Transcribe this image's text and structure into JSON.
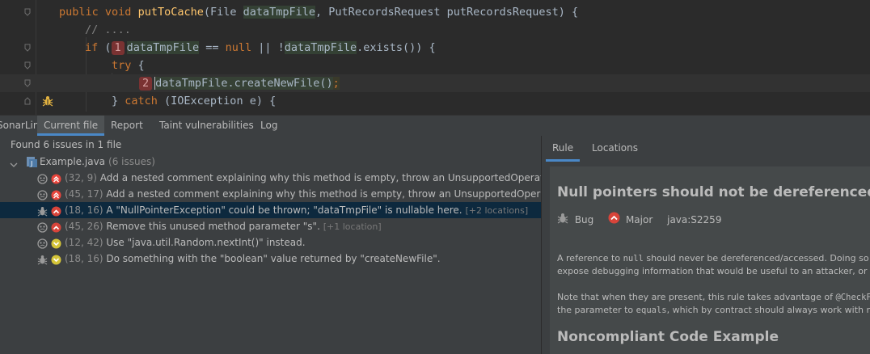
{
  "editor": {
    "line1": {
      "kw1": "public",
      "kw2": "void",
      "method": "putToCache",
      "p_open": "(File ",
      "param1": "dataTmpFile",
      "p_mid": ", PutRecordsRequest putRecordsRequest) {"
    },
    "line2": {
      "comment": "// ...."
    },
    "line3": {
      "kw": "if",
      "open": " (",
      "badge": "1",
      "var": "dataTmpFile",
      "op": " == ",
      "null_kw": "null",
      "mid": " || !",
      "var2": "dataTmpFile",
      "tail": ".exists()) {"
    },
    "line4": {
      "kw": "try",
      "tail": " {"
    },
    "line5": {
      "badge": "2",
      "var": "dataTmpFile",
      "call": ".createNewFile()",
      "semi": ";"
    },
    "line6": {
      "open": "} ",
      "kw": "catch",
      "tail": " (IOException e) {"
    }
  },
  "toolwindow": {
    "title": "SonarLint:",
    "tabs": [
      "Current file",
      "Report",
      "Taint vulnerabilities",
      "Log"
    ],
    "selected_tab": "Current file"
  },
  "issues": {
    "summary": "Found 6 issues in 1 file",
    "file_name": "Example.java",
    "file_count": "(6 issues)",
    "items": [
      {
        "loc": "(32, 9)",
        "msg": "Add a nested comment explaining why this method is empty, throw an UnsupportedOperationException or complete the implementation.",
        "extra": "",
        "type": "code-smell",
        "severity": "critical"
      },
      {
        "loc": "(45, 17)",
        "msg": "Add a nested comment explaining why this method is empty, throw an UnsupportedOperationException or complete the implementation.",
        "extra": "",
        "type": "code-smell",
        "severity": "critical"
      },
      {
        "loc": "(18, 16)",
        "msg": "A \"NullPointerException\" could be thrown; \"dataTmpFile\" is nullable here.",
        "extra": "[+2 locations]",
        "type": "bug",
        "severity": "major"
      },
      {
        "loc": "(45, 26)",
        "msg": "Remove this unused method parameter \"s\".",
        "extra": "[+1 location]",
        "type": "code-smell",
        "severity": "major"
      },
      {
        "loc": "(12, 42)",
        "msg": "Use \"java.util.Random.nextInt()\" instead.",
        "extra": "",
        "type": "code-smell",
        "severity": "minor"
      },
      {
        "loc": "(18, 16)",
        "msg": "Do something with the \"boolean\" value returned by \"createNewFile\".",
        "extra": "",
        "type": "bug",
        "severity": "minor"
      }
    ]
  },
  "rule_panel": {
    "tabs": [
      "Rule",
      "Locations"
    ],
    "selected_tab": "Rule",
    "title": "Null pointers should not be dereferenced",
    "type": "Bug",
    "severity": "Major",
    "key": "java:S2259",
    "p1_a": "A reference to ",
    "p1_code": "null",
    "p1_b": " should never be dereferenced/accessed. Doing so will cause a NullPointerException to be thrown. At best, such an exception will",
    "p1_line2": "expose debugging information that would be useful to an attacker, or it could allow an attacker to bypass security measures.",
    "p2_a": "Note that when they are present, this rule takes advantage of ",
    "p2_code": "@CheckForNull",
    "p2_line2_a": "the parameter to ",
    "p2_line2_code": "equals",
    "p2_line2_b": ", which by contract should always work with null.",
    "section": "Noncompliant Code Example"
  },
  "colors": {
    "accent": "#4a88c7",
    "selection": "#0d293e",
    "badge": "#7a3232",
    "critical": "#e8453c",
    "minor": "#d4c438"
  }
}
